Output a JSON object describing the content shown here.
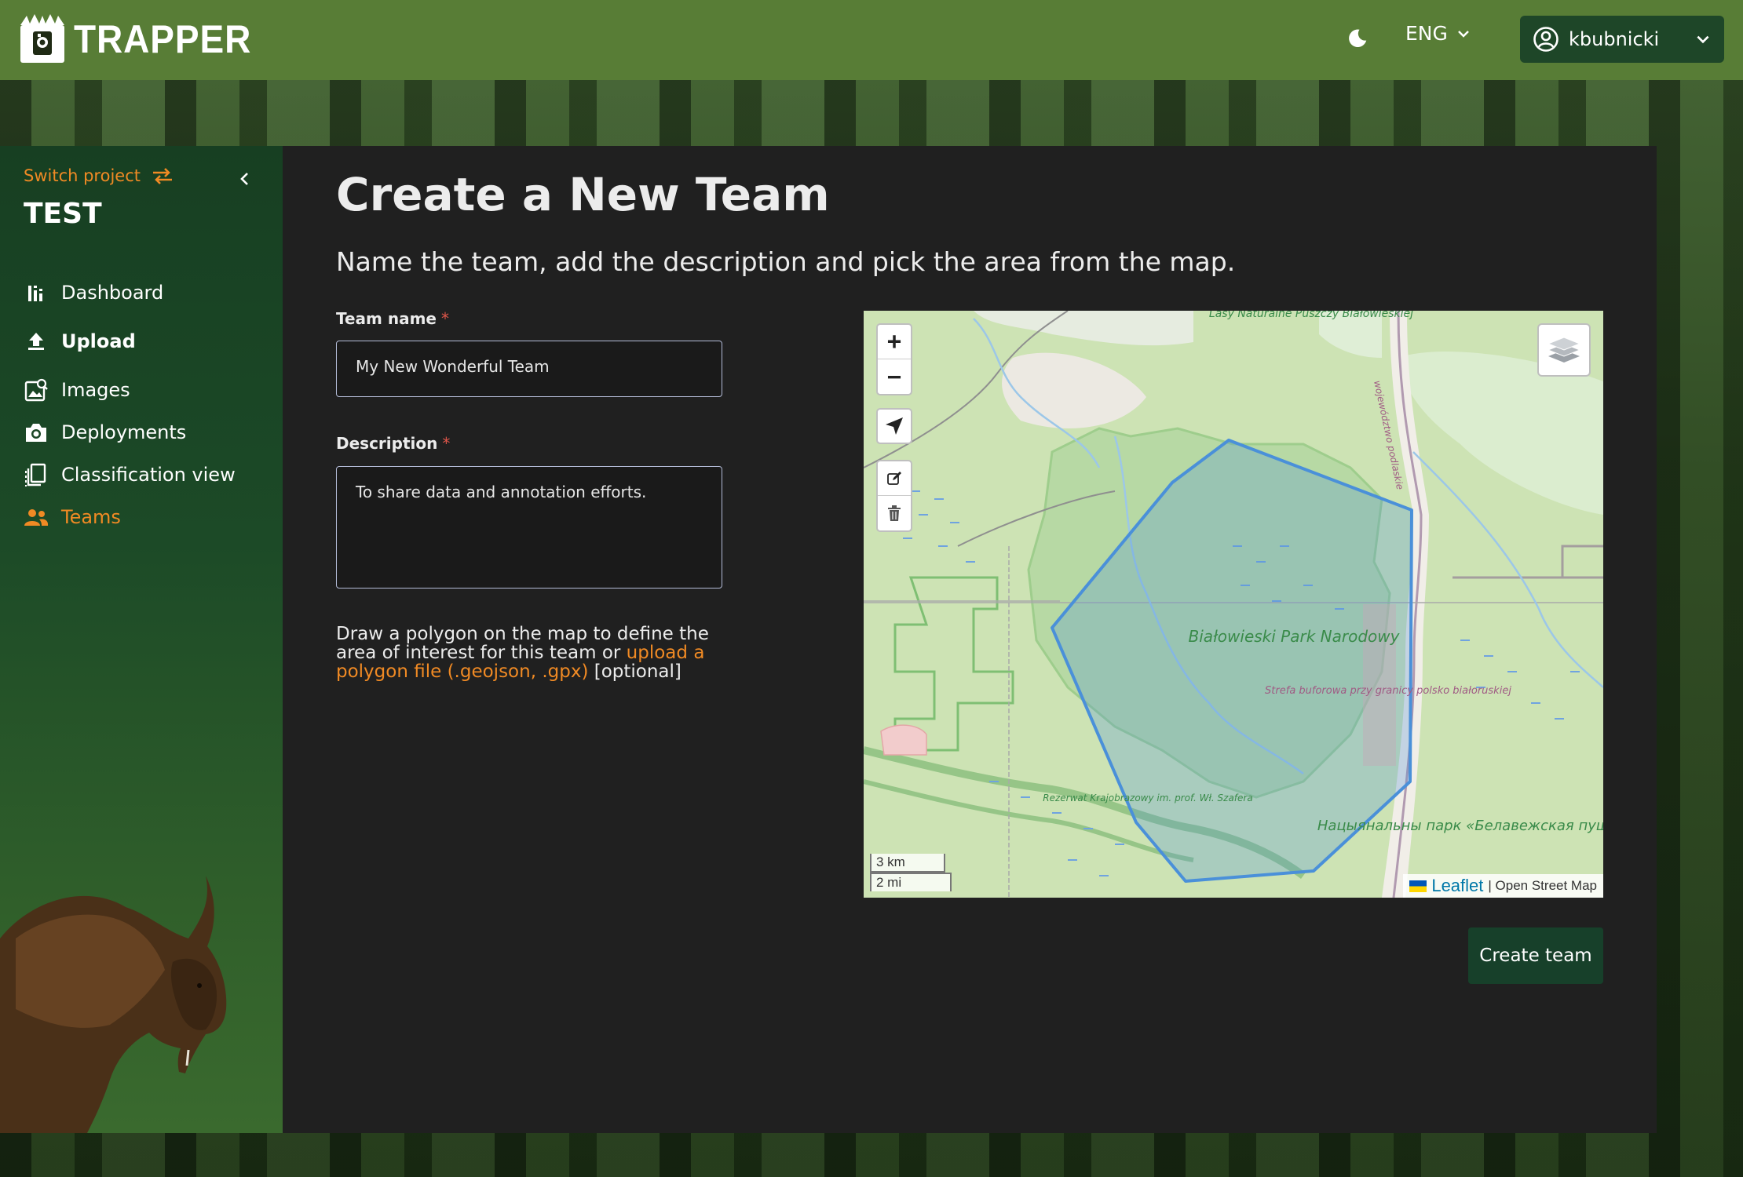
{
  "app": {
    "logo_text": "TRAPPER"
  },
  "header": {
    "theme_icon": "moon-icon",
    "language": "ENG",
    "username": "kbubnicki"
  },
  "sidebar": {
    "switch_project_label": "Switch project",
    "project_name": "TEST",
    "items": [
      {
        "label": "Dashboard",
        "icon": "bar-chart-icon"
      },
      {
        "label": "Upload",
        "icon": "upload-icon"
      },
      {
        "label": "Images",
        "icon": "images-icon"
      },
      {
        "label": "Deployments",
        "icon": "camera-icon"
      },
      {
        "label": "Classification view",
        "icon": "classification-icon"
      },
      {
        "label": "Teams",
        "icon": "teams-icon",
        "active": true
      }
    ]
  },
  "main": {
    "title": "Create a New Team",
    "subtitle": "Name the team, add the description and pick the area from the map.",
    "team_name": {
      "label": "Team name",
      "required_mark": "*",
      "value": "My New Wonderful Team"
    },
    "description": {
      "label": "Description",
      "required_mark": "*",
      "value": "To share data and annotation efforts."
    },
    "polygon_help": {
      "text_before": "Draw a polygon on the map to define the area of interest for this team or ",
      "link_text": "upload a polygon file (.geojson, .gpx)",
      "text_after": " [optional]"
    },
    "create_button": "Create team"
  },
  "map": {
    "zoom_in": "+",
    "zoom_out": "−",
    "scale_km": "3 km",
    "scale_mi": "2 mi",
    "attribution_leaflet": "Leaflet",
    "attribution_rest": "| Open Street Map",
    "labels": {
      "forest_reserve": "Lasy Naturalne Puszczy Białowieskiej",
      "national_park": "Białowieski Park Narodowy",
      "buffer_zone": "Strefa buforowa przy granicy polsko białoruskiej",
      "landscape_reserve": "Rezerwat Krajobrazowy im. prof. Wł. Szafera",
      "border_road": "województwo podlaskie",
      "belarus_park": "Нацыянальны парк «Белавежская пушча»"
    }
  },
  "colors": {
    "accent": "#f08a24",
    "header_bg": "#587d36",
    "sidebar_bg": "#173f22",
    "polygon": "#4a90d9"
  }
}
